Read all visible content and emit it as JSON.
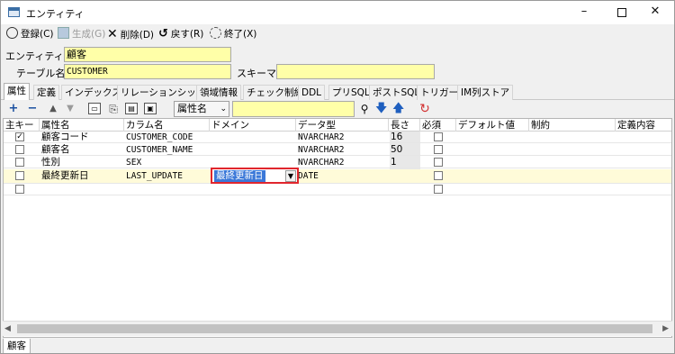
{
  "window": {
    "title": "エンティティ",
    "min": "–",
    "close": "✕"
  },
  "toolbar": {
    "register": "登録(C)",
    "generate": "生成(G)",
    "delete": "削除(D)",
    "revert": "戻す(R)",
    "exit": "終了(X)"
  },
  "entity": {
    "name_label": "エンティティ名",
    "name_value": "顧客",
    "table_label": "テーブル名",
    "table_value": "CUSTOMER",
    "schema_label": "スキーマ",
    "schema_value": ""
  },
  "tabs": [
    "属性",
    "定義",
    "インデックス",
    "リレーションシップ",
    "領域情報",
    "チェック制約",
    "DDL",
    "プリSQL",
    "ポストSQL",
    "トリガー",
    "IM列ストア"
  ],
  "gridtoolbar": {
    "add": "+",
    "remove": "−",
    "up": "▲",
    "down": "▼",
    "search_combo": "属性名",
    "search_value": ""
  },
  "grid": {
    "columns": [
      "主キー",
      "属性名",
      "カラム名",
      "ドメイン",
      "データ型",
      "長さ",
      "必須",
      "デフォルト値",
      "制約",
      "定義内容"
    ],
    "rows": [
      {
        "pk": true,
        "attr": "顧客コード",
        "col": "CUSTOMER_CODE",
        "domain": "",
        "type": "NVARCHAR2",
        "len": "16",
        "req": false
      },
      {
        "pk": false,
        "attr": "顧客名",
        "col": "CUSTOMER_NAME",
        "domain": "",
        "type": "NVARCHAR2",
        "len": "50",
        "req": false
      },
      {
        "pk": false,
        "attr": "性別",
        "col": "SEX",
        "domain": "",
        "type": "NVARCHAR2",
        "len": "1",
        "req": false
      },
      {
        "pk": false,
        "attr": "最終更新日",
        "col": "LAST_UPDATE",
        "domain": "最終更新日",
        "type": "DATE",
        "len": "",
        "req": false
      },
      {
        "pk": false,
        "attr": "",
        "col": "",
        "domain": "",
        "type": "",
        "len": "",
        "req": false
      }
    ]
  },
  "statusbar": {
    "tab": "顧客"
  },
  "colors": {
    "input_bg": "#ffffa8",
    "highlight": "#3b78d8",
    "focus_border": "#e0262d"
  }
}
